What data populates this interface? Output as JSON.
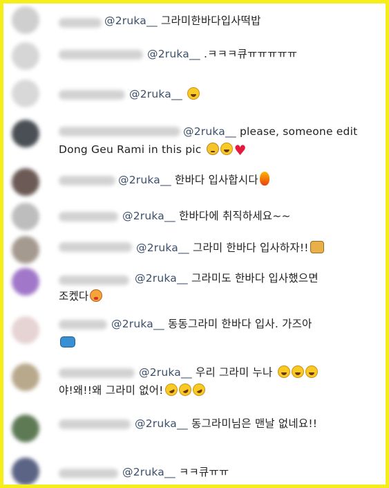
{
  "comments": [
    {
      "mention": "@2ruka__",
      "text": " 그라미한바다입사떡밥",
      "avatar_color": "#cfcfcf"
    },
    {
      "mention": "@2ruka__",
      "text": " .ㅋㅋㅋ큐ㅠㅠㅠㅠㅠ",
      "avatar_color": "#d6d6d6"
    },
    {
      "mention": "@2ruka__",
      "text": " ",
      "emoji_after": [
        "laughing-tears"
      ],
      "avatar_color": "#d8d8d8"
    },
    {
      "mention": "@2ruka__",
      "text": " please, someone edit",
      "line2": "Dong Geu Rami in this pic ",
      "emoji_after": [
        "sad-face",
        "laughing-tears",
        "red-heart"
      ],
      "avatar_color": "#4a4f55"
    },
    {
      "mention": "@2ruka__",
      "text": " 한바다 입사합시다",
      "emoji_after": [
        "fire"
      ],
      "avatar_color": "#6b5a55"
    },
    {
      "mention": "@2ruka__",
      "text": " 한바다에 취직하세요~~",
      "avatar_color": "#bdbdbd"
    },
    {
      "mention": "@2ruka__",
      "text": " 그라미 한바다 입사하자!!",
      "emoji_after": [
        "raising-hands"
      ],
      "avatar_color": "#a59a90"
    },
    {
      "mention": "@2ruka__",
      "text": " 그라미도 한바다 입사했으면",
      "line2": "조켔다",
      "emoji_after": [
        "yum-face"
      ],
      "avatar_color": "#a178c9"
    },
    {
      "mention": "@2ruka__",
      "text": " 동동그라미 한바다 입사. 가즈아",
      "emoji_line2": [
        "car"
      ],
      "avatar_color": "#e6d3d3"
    },
    {
      "mention": "@2ruka__",
      "text": " 우리 그라미 누나 ",
      "emoji_after": [
        "laughing-tears",
        "laughing-tears",
        "laughing-tears"
      ],
      "line2": "야!왜!!왜 그라미 없어!",
      "emoji_line2": [
        "rofl",
        "rofl",
        "rofl"
      ],
      "avatar_color": "#b8a98c"
    },
    {
      "mention": "@2ruka__",
      "text": " 동그라미님은 맨날 없네요!!",
      "avatar_color": "#5e7a55"
    },
    {
      "mention": "@2ruka__",
      "text": " ㅋㅋ큐ㅠㅠ",
      "avatar_color": "#5b6485"
    }
  ],
  "colors": {
    "frame": "#f6ee1b",
    "mention": "#3b4f6b",
    "text": "#222222"
  }
}
